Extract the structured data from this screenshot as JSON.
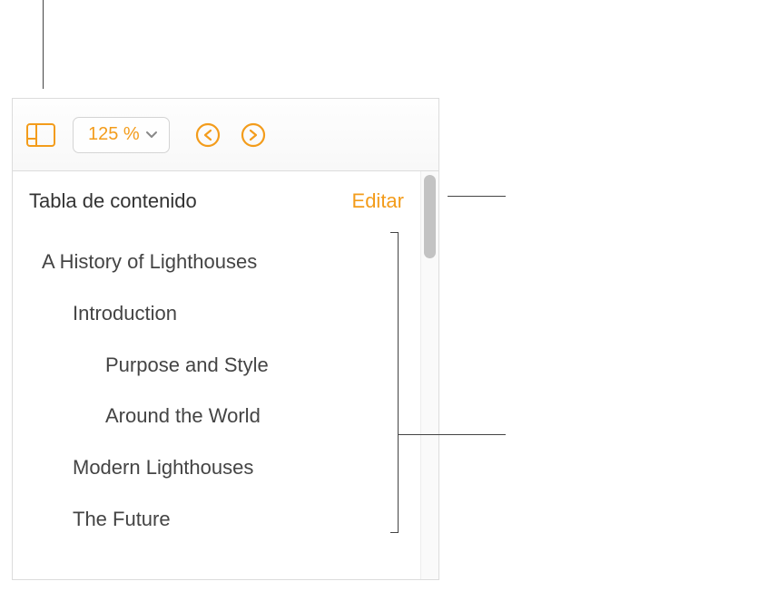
{
  "toolbar": {
    "zoom_value": "125 %"
  },
  "toc": {
    "title": "Tabla de contenido",
    "edit_label": "Editar",
    "items": [
      {
        "label": "A History of Lighthouses",
        "level": 0
      },
      {
        "label": "Introduction",
        "level": 1
      },
      {
        "label": "Purpose and Style",
        "level": 2
      },
      {
        "label": "Around the World",
        "level": 2
      },
      {
        "label": "Modern Lighthouses",
        "level": 1
      },
      {
        "label": "The Future",
        "level": 1
      }
    ]
  },
  "colors": {
    "accent": "#f39c1b"
  }
}
